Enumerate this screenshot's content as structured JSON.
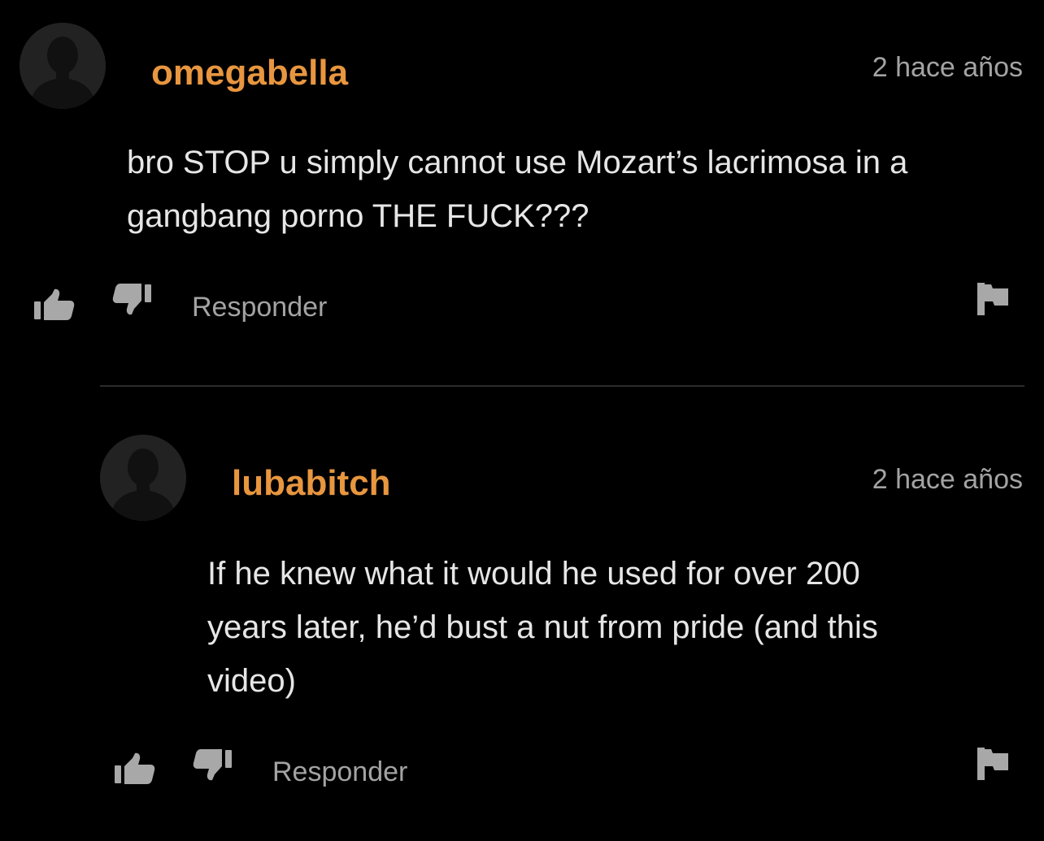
{
  "comments": [
    {
      "username": "omegabella",
      "timestamp": "2 hace años",
      "text_lines": [
        "bro STOP u simply cannot use Mozart’s lacrimosa in a",
        "gangbang porno THE FUCK???"
      ],
      "reply_label": "Responder",
      "avatar_icon": "default-user-avatar-icon"
    },
    {
      "username": "lubabitch",
      "timestamp": "2 hace años",
      "text_lines": [
        "If he knew what it would he used for over 200",
        "years later, he’d bust a nut from pride (and this",
        "video)"
      ],
      "reply_label": "Responder",
      "avatar_icon": "default-user-avatar-icon"
    }
  ],
  "icons": {
    "like": "thumbs-up-icon",
    "dislike": "thumbs-down-icon",
    "report": "flag-icon"
  },
  "colors": {
    "background": "#000000",
    "username": "#e8963f",
    "body_text": "#e6e6e6",
    "muted_text": "#a3a3a3",
    "icon": "#a8a8a8",
    "divider": "#2c2c2c",
    "avatar_bg": "#222222",
    "avatar_silhouette": "#111111"
  }
}
